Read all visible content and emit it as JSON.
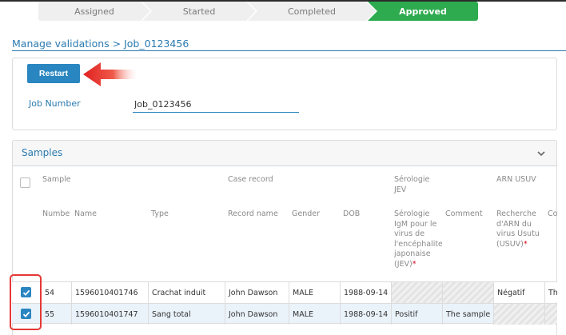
{
  "stepper": {
    "steps": [
      "Assigned",
      "Started",
      "Completed",
      "Approved"
    ],
    "active": "Approved",
    "active_color": "#2eab4f"
  },
  "breadcrumb": "Manage validations > Job_0123456",
  "top_panel": {
    "restart_label": "Restart",
    "job_number_label": "Job Number",
    "job_number_value": "Job_0123456"
  },
  "samples": {
    "title": "Samples",
    "group_headers": {
      "sample": "Sample",
      "case_record": "Case record",
      "serologie_jev": [
        "Sérologie",
        "JEV"
      ],
      "arn_usuv": "ARN USUV"
    },
    "columns": {
      "number": "Numbe",
      "name": "Name",
      "type": "Type",
      "record_name": "Record name",
      "gender": "Gender",
      "dob": "DOB",
      "serologie": [
        "Sérologie",
        "IgM pour le",
        "virus de",
        "l'encéphalite",
        "japonaise",
        "(JEV)"
      ],
      "comment": "Comment",
      "recherche": [
        "Recherche",
        "d'ARN du",
        "virus Usutu",
        "(USUV)"
      ],
      "co": "Co"
    },
    "rows": [
      {
        "number": "54",
        "name": "1596010401746",
        "type": "Crachat induit",
        "record_name": "John Dawson",
        "gender": "MALE",
        "dob": "1988-09-14",
        "serologie": "",
        "comment": "",
        "recherche": "Négatif",
        "co": "Th"
      },
      {
        "number": "55",
        "name": "1596010401747",
        "type": "Sang total",
        "record_name": "John Dawson",
        "gender": "MALE",
        "dob": "1988-09-14",
        "serologie": "Positif",
        "comment": "The sample",
        "recherche": "",
        "co": ""
      }
    ]
  }
}
